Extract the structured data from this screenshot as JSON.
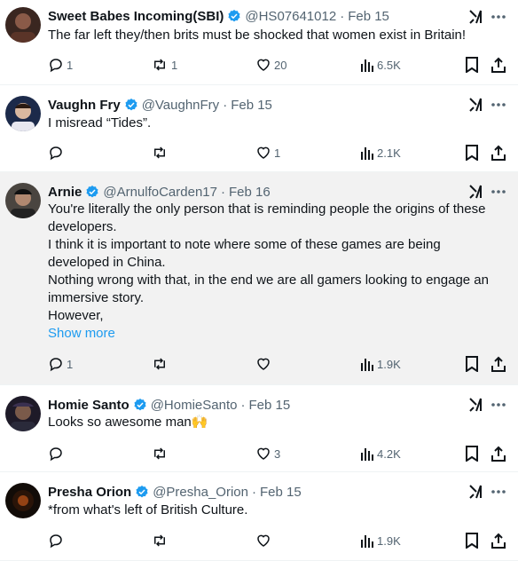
{
  "tweets": [
    {
      "name": "Sweet Babes Incoming(SBI)",
      "handle": "@HS07641012",
      "date": "Feb 15",
      "text": [
        "The far left they/then brits must be shocked that  women exist in Britain!"
      ],
      "show_more": "",
      "replies": "1",
      "reposts": "1",
      "likes": "20",
      "views": "6.5K",
      "avatar_color": "#3a2620"
    },
    {
      "name": "Vaughn Fry",
      "handle": "@VaughnFry",
      "date": "Feb 15",
      "text": [
        "I misread “Tides”."
      ],
      "show_more": "",
      "replies": "",
      "reposts": "",
      "likes": "1",
      "views": "2.1K",
      "avatar_color": "#1c2a4a"
    },
    {
      "name": "Arnie",
      "handle": "@ArnulfoCarden17",
      "date": "Feb 16",
      "text": [
        "You're literally the only person that is reminding people the origins of these developers.",
        "I think it is important to note where some of these games are being developed in China.",
        "Nothing wrong with that, in the end we are all gamers looking to engage an immersive story.",
        "However,"
      ],
      "show_more": "Show more",
      "replies": "1",
      "reposts": "",
      "likes": "",
      "views": "1.9K",
      "avatar_color": "#4a4540"
    },
    {
      "name": "Homie Santo",
      "handle": "@HomieSanto",
      "date": "Feb 15",
      "text": [
        "Looks so awesome man🙌"
      ],
      "show_more": "",
      "replies": "",
      "reposts": "",
      "likes": "3",
      "views": "4.2K",
      "avatar_color": "#1e1a28"
    },
    {
      "name": "Presha Orion",
      "handle": "@Presha_Orion",
      "date": "Feb 15",
      "text": [
        "*from what's left of British Culture."
      ],
      "show_more": "",
      "replies": "",
      "reposts": "",
      "likes": "",
      "views": "1.9K",
      "avatar_color": "#120c08"
    }
  ],
  "colors": {
    "accent": "#1d9bf0",
    "muted": "#536471",
    "text": "#0f1419",
    "highlight_bg": "#f2f2f2"
  },
  "icons": [
    "verified-badge-icon",
    "grok-icon",
    "more-icon",
    "reply-icon",
    "repost-icon",
    "like-icon",
    "views-icon",
    "bookmark-icon",
    "share-icon"
  ]
}
